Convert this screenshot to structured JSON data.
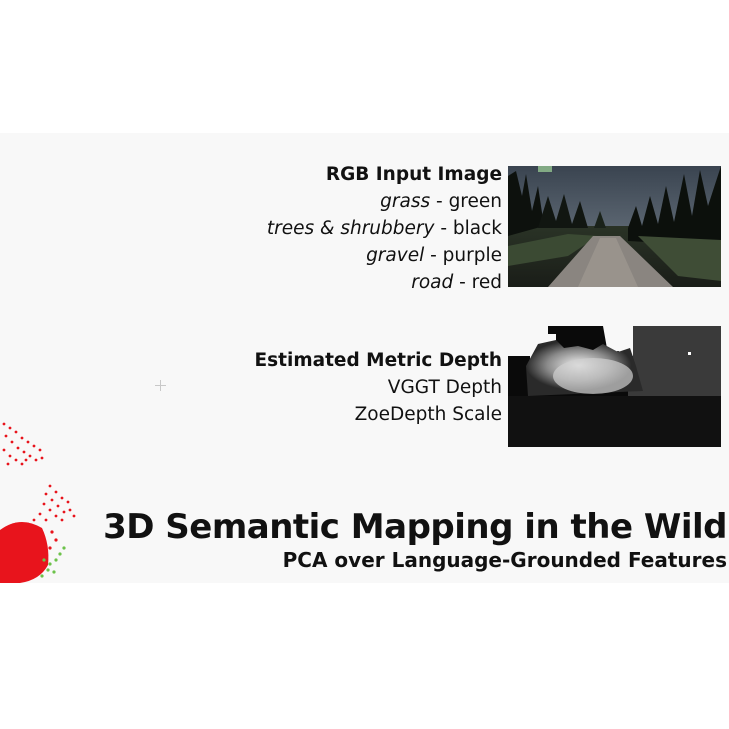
{
  "rgb_block": {
    "heading": "RGB Input Image",
    "legend": [
      {
        "term": "grass",
        "sep": " - ",
        "color_name": "green"
      },
      {
        "term": "trees & shrubbery",
        "sep": " - ",
        "color_name": "black"
      },
      {
        "term": "gravel",
        "sep": " - ",
        "color_name": "purple"
      },
      {
        "term": "road",
        "sep": " - ",
        "color_name": "red"
      }
    ]
  },
  "depth_block": {
    "heading": "Estimated Metric Depth",
    "lines": [
      "VGGT Depth",
      "ZoeDepth Scale"
    ]
  },
  "title": "3D Semantic Mapping in the Wild",
  "subtitle": "PCA over Language-Grounded Features",
  "colors": {
    "point_cloud_primary": "#e8141c",
    "point_cloud_secondary": "#6cc24a",
    "panel_bg": "#f8f8f8"
  }
}
